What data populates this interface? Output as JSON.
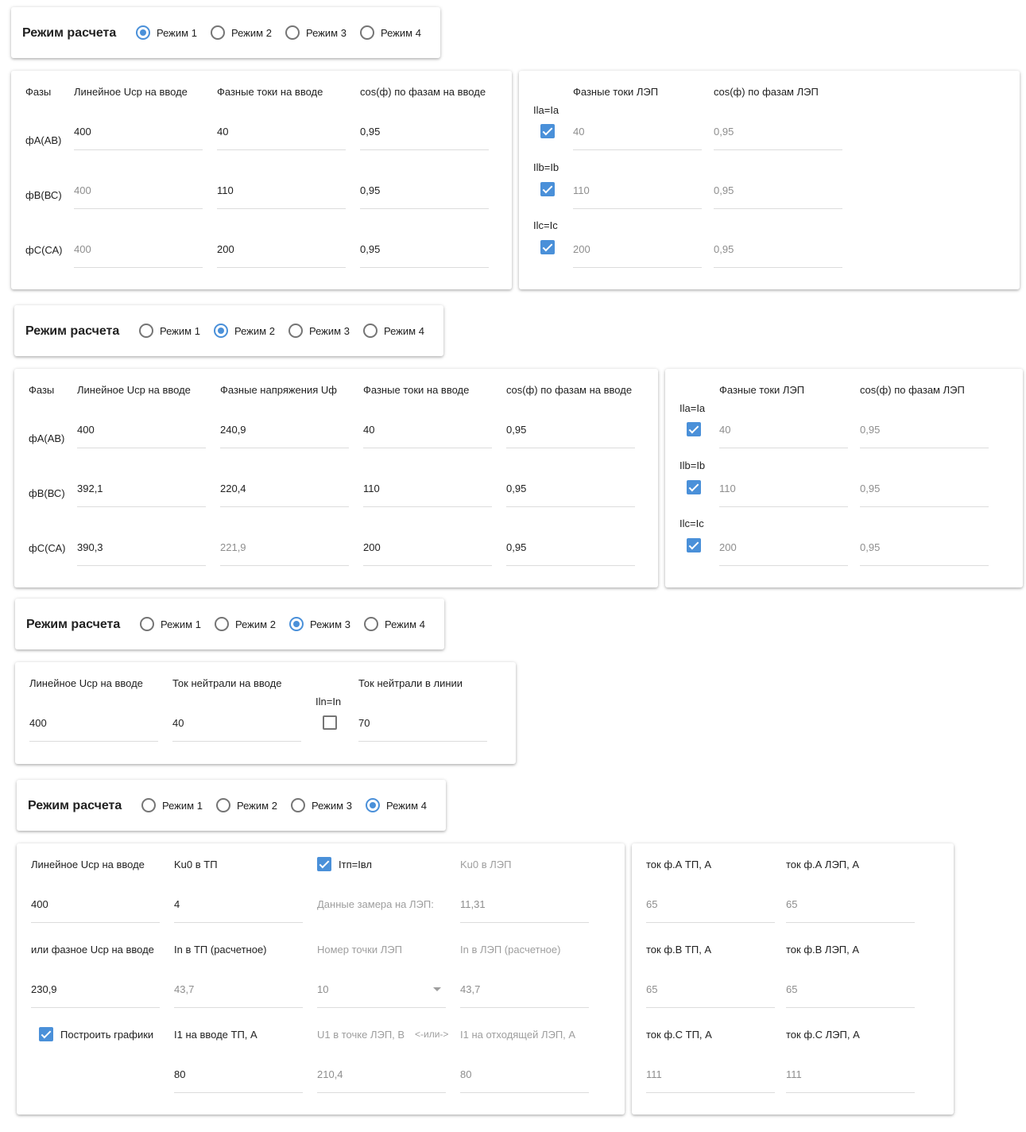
{
  "mode_label": "Режим расчета",
  "mode_options": [
    "Режим 1",
    "Режим 2",
    "Режим 3",
    "Режим 4"
  ],
  "m1": {
    "headers": {
      "phases": "Фазы",
      "ucp": "Линейное Uср на вводе",
      "ti": "Фазные токи на вводе",
      "cosi": "cos(ф) по фазам на вводе"
    },
    "phases": [
      "фА(АВ)",
      "фВ(ВС)",
      "фС(СА)"
    ],
    "ucp": [
      "400",
      "400",
      "400"
    ],
    "ti": [
      "40",
      "110",
      "200"
    ],
    "cosi": [
      "0,95",
      "0,95",
      "0,95"
    ],
    "line_headers": {
      "tl": "Фазные токи ЛЭП",
      "cosl": "cos(ф) по фазам ЛЭП"
    },
    "checks": [
      "Ila=Ia",
      "Ilb=Ib",
      "Ilc=Ic"
    ],
    "tl": [
      "40",
      "110",
      "200"
    ],
    "cosl": [
      "0,95",
      "0,95",
      "0,95"
    ]
  },
  "m2": {
    "headers": {
      "phases": "Фазы",
      "ucp": "Линейное Uср на вводе",
      "uf": "Фазные напряжения Uф",
      "ti": "Фазные токи на вводе",
      "cosi": "cos(ф) по фазам на вводе"
    },
    "phases": [
      "фА(АВ)",
      "фВ(ВС)",
      "фС(СА)"
    ],
    "ucp": [
      "400",
      "392,1",
      "390,3"
    ],
    "uf": [
      "240,9",
      "220,4",
      "221,9"
    ],
    "ti": [
      "40",
      "110",
      "200"
    ],
    "cosi": [
      "0,95",
      "0,95",
      "0,95"
    ],
    "line_headers": {
      "tl": "Фазные токи ЛЭП",
      "cosl": "cos(ф) по фазам ЛЭП"
    },
    "checks": [
      "Ila=Ia",
      "Ilb=Ib",
      "Ilc=Ic"
    ],
    "tl": [
      "40",
      "110",
      "200"
    ],
    "cosl": [
      "0,95",
      "0,95",
      "0,95"
    ]
  },
  "m3": {
    "headers": {
      "ucp": "Линейное Uср на вводе",
      "tn": "Ток нейтрали на вводе",
      "tnl": "Ток нейтрали в линии"
    },
    "check": "Iln=In",
    "ucp": "400",
    "tn": "40",
    "tnl": "70"
  },
  "m4": {
    "ucp_label": "Линейное Uср на вводе",
    "ucp": "400",
    "ku0_tp_label": "Ku0 в ТП",
    "ku0_tp": "4",
    "itp_label": "Iтп=Iвл",
    "ku0_lep_label": "Ku0 в ЛЭП",
    "measure_label": "Данные замера на ЛЭП:",
    "ku0_lep": "11,31",
    "uf_label": "или фазное Uср на вводе",
    "uf": "230,9",
    "in_tp_label": "In в ТП (расчетное)",
    "in_tp": "43,7",
    "point_label": "Номер точки ЛЭП",
    "point": "10",
    "in_lep_label": "In в ЛЭП (расчетное)",
    "in_lep": "43,7",
    "plot_label": "Построить графики",
    "i1_tp_label": "I1 на вводе ТП, А",
    "i1_tp": "80",
    "u1_label": "U1 в точке ЛЭП, В",
    "or_label": "<-или->",
    "i1_out_label": "I1 на отходящей ЛЭП, А",
    "u1": "210,4",
    "i1_out": "80",
    "right": {
      "a_tp_label": "ток ф.А ТП, А",
      "a_tp": "65",
      "a_lep_label": "ток ф.А ЛЭП, А",
      "a_lep": "65",
      "b_tp_label": "ток ф.В ТП, А",
      "b_tp": "65",
      "b_lep_label": "ток ф.В ЛЭП, А",
      "b_lep": "65",
      "c_tp_label": "ток ф.С ТП, А",
      "c_tp": "111",
      "c_lep_label": "ток ф.С ЛЭП, А",
      "c_lep": "111"
    }
  },
  "colors": {
    "accent": "#4a90d9"
  }
}
